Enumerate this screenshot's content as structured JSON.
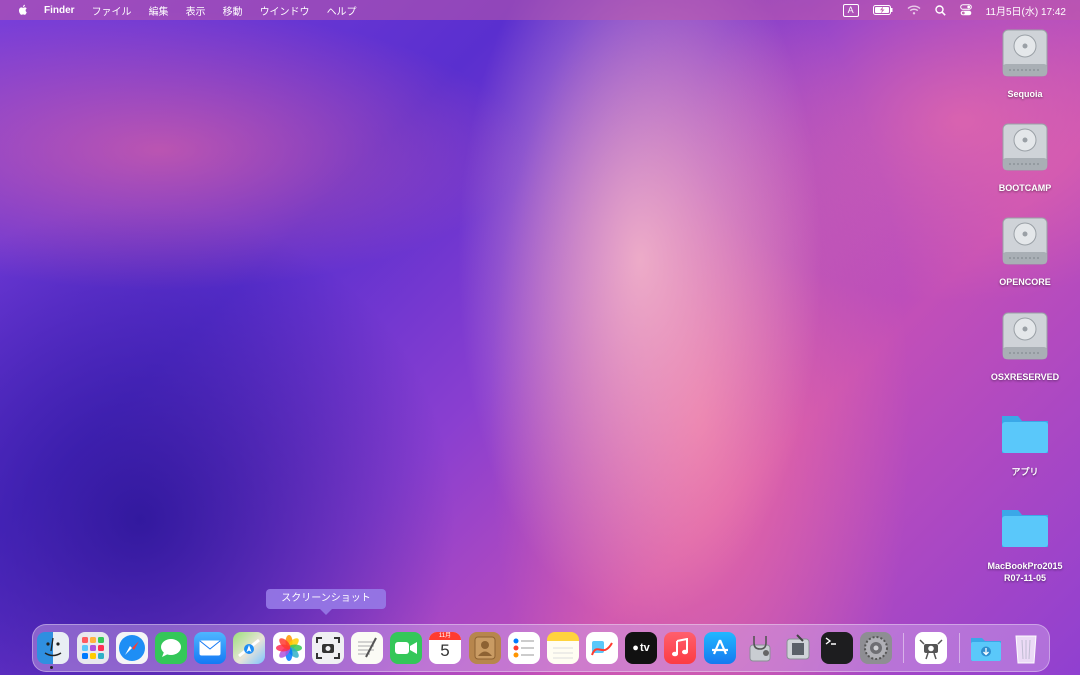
{
  "menubar": {
    "app_name": "Finder",
    "items": [
      "ファイル",
      "編集",
      "表示",
      "移動",
      "ウインドウ",
      "ヘルプ"
    ],
    "input_indicator": "A",
    "clock": "11月5日(水) 17:42",
    "icons": [
      "apple-icon",
      "input-source-icon",
      "battery-icon",
      "wifi-icon",
      "search-icon",
      "control-center-icon"
    ]
  },
  "desktop": {
    "icons": [
      {
        "label": "Sequoia",
        "type": "disk"
      },
      {
        "label": "BOOTCAMP",
        "type": "disk"
      },
      {
        "label": "OPENCORE",
        "type": "disk"
      },
      {
        "label": "OSXRESERVED",
        "type": "disk"
      },
      {
        "label": "アプリ",
        "type": "folder"
      },
      {
        "label": "MacBookPro2015 R07-11-05",
        "type": "folder"
      }
    ]
  },
  "tooltip": {
    "text": "スクリーンショット"
  },
  "dock": {
    "calendar_month": "11月",
    "calendar_day": "5",
    "tv_label": "tv",
    "apps": [
      "Finder",
      "Launchpad",
      "Safari",
      "Messages",
      "Mail",
      "Maps",
      "Photos",
      "Screenshot",
      "TextEdit",
      "FaceTime",
      "Calendar",
      "Contacts",
      "Reminders",
      "Notes",
      "Freeform",
      "TV",
      "Music",
      "App Store",
      "Disk Utility",
      "System Information",
      "Terminal",
      "System Settings",
      "Screenshot Utility",
      "Downloads",
      "Trash"
    ]
  },
  "colors": {
    "folder": "#5ac8fa",
    "accent": "#b46ac8"
  }
}
